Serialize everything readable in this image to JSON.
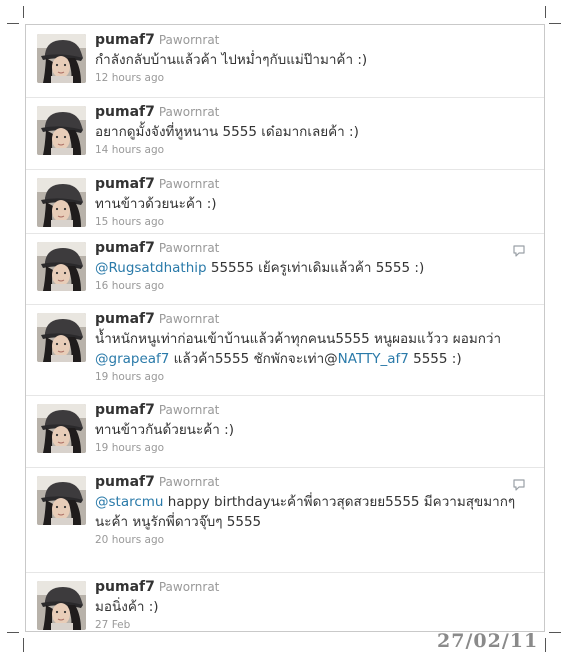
{
  "tweets": [
    {
      "screen_name": "pumaf7",
      "full_name": "Pawornrat",
      "time": "12 hours ago",
      "reply": false,
      "parts": [
        {
          "t": "กำลังกลับบ้านแล้วค้า ไปหม่ำๆกับแม่ป๊ามาค้า :)"
        }
      ]
    },
    {
      "screen_name": "pumaf7",
      "full_name": "Pawornrat",
      "time": "14 hours ago",
      "reply": false,
      "parts": [
        {
          "t": "อยากดูมั้งจังที่หูหนาน 5555 เด๋อมากเลยค้า :)"
        }
      ]
    },
    {
      "screen_name": "pumaf7",
      "full_name": "Pawornrat",
      "time": "15 hours ago",
      "reply": false,
      "parts": [
        {
          "t": "ทานข้าวด้วยนะค้า :)"
        }
      ]
    },
    {
      "screen_name": "pumaf7",
      "full_name": "Pawornrat",
      "time": "16 hours ago",
      "reply": true,
      "parts": [
        {
          "t": "@Rugsatdhathip",
          "m": true
        },
        {
          "t": " 55555 เย้ครูเท่าเดิมแล้วค้า 5555 :)"
        }
      ]
    },
    {
      "screen_name": "pumaf7",
      "full_name": "Pawornrat",
      "time": "19 hours ago",
      "reply": false,
      "parts": [
        {
          "t": "น้ำหนักหนูเท่าก่อนเข้าบ้านแล้วค้าทุกคนน5555 หนูผอมแว้วว ผอมกว่า "
        },
        {
          "t": "@grapeaf7",
          "m": true
        },
        {
          "t": " แล้วค้า5555 ชักพักจะเท่า@"
        },
        {
          "t": "NATTY_af7",
          "m": true
        },
        {
          "t": " 5555 :)"
        }
      ]
    },
    {
      "screen_name": "pumaf7",
      "full_name": "Pawornrat",
      "time": "19 hours ago",
      "reply": false,
      "parts": [
        {
          "t": "ทานข้าวกันด้วยนะค้า :)"
        }
      ]
    },
    {
      "screen_name": "pumaf7",
      "full_name": "Pawornrat",
      "time": "20 hours ago",
      "reply": true,
      "parts": [
        {
          "t": "@starcmu",
          "m": true
        },
        {
          "t": " happy birthdayนะค้าพี่ดาวสุดสวยย5555 มีความสุขมากๆนะค้า หนูรักพี่ดาวจุ๊บๆ 5555"
        }
      ]
    },
    {
      "screen_name": "pumaf7",
      "full_name": "Pawornrat",
      "time": "27 Feb",
      "reply": false,
      "parts": [
        {
          "t": "มอนิ่งค้า :)"
        }
      ]
    }
  ],
  "stamp_date": "27/02/11",
  "colors": {
    "mention": "#2a7aa9",
    "meta": "#999999",
    "text": "#333333"
  }
}
